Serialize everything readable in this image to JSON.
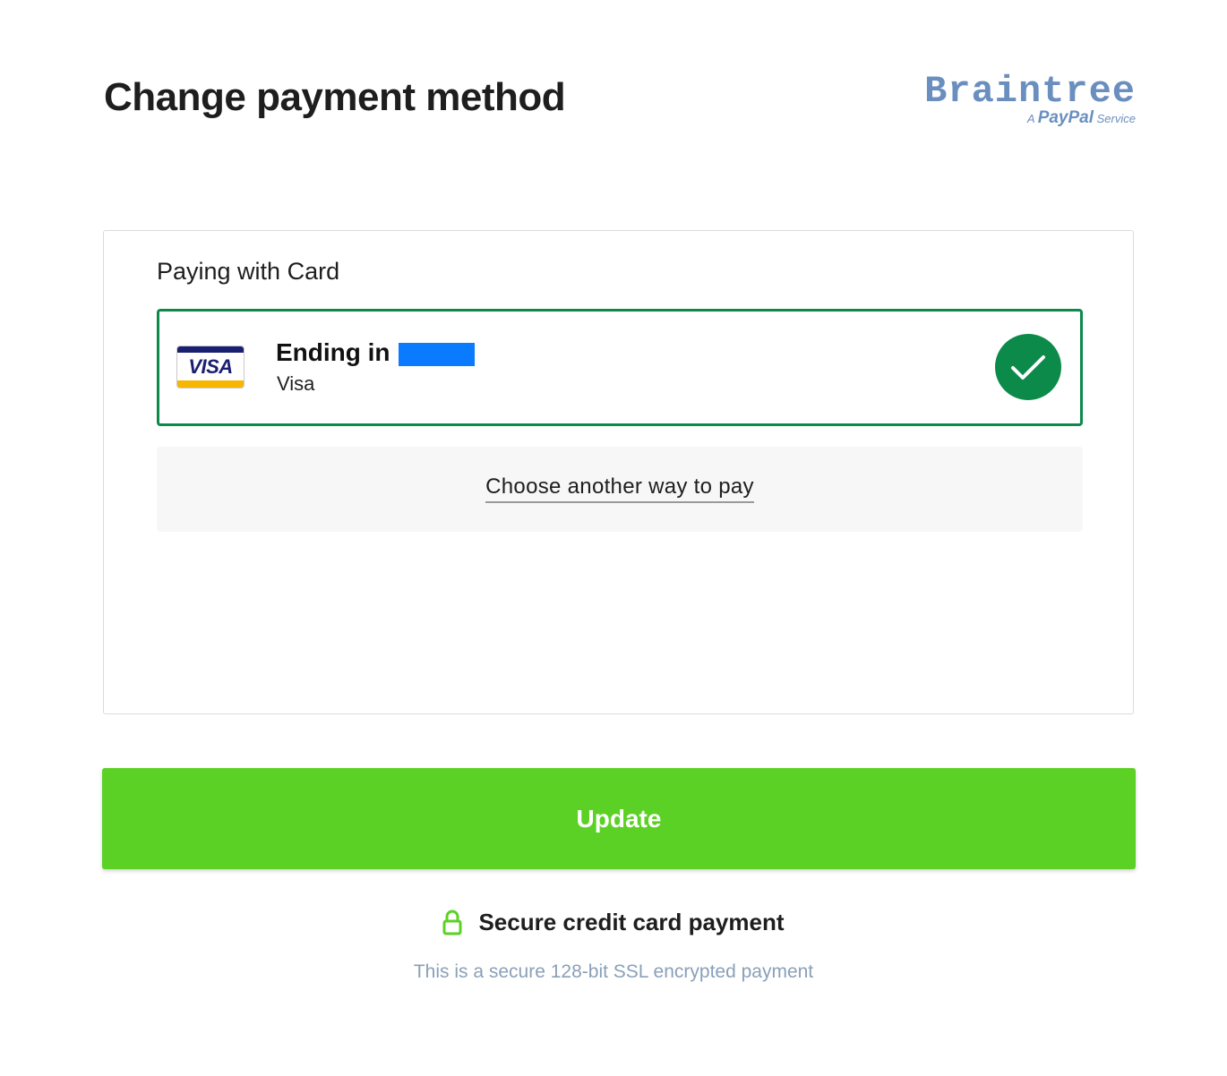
{
  "header": {
    "title": "Change payment method",
    "logo": {
      "wordmark": "Braintree",
      "prefix": "A",
      "paypal": "PayPal",
      "suffix": "Service"
    }
  },
  "panel": {
    "heading": "Paying with Card",
    "selected_method": {
      "card_logo_text": "VISA",
      "ending_label": "Ending in",
      "ending_digits_masked": true,
      "brand": "Visa",
      "selected": true,
      "icon": "checkmark-icon"
    },
    "other_option_label": "Choose another way to pay"
  },
  "update_button": {
    "label": "Update"
  },
  "security": {
    "icon": "lock-icon",
    "title": "Secure credit card payment",
    "description": "This is a secure 128-bit SSL encrypted payment"
  },
  "colors": {
    "title": "#1e1e1e",
    "logo": "#6a8fbf",
    "selected_border": "#0b8a4a",
    "mask": "#0a7aff",
    "update_button": "#5cd125",
    "lock": "#5cd125",
    "ssl_text": "#8aa0b8"
  }
}
